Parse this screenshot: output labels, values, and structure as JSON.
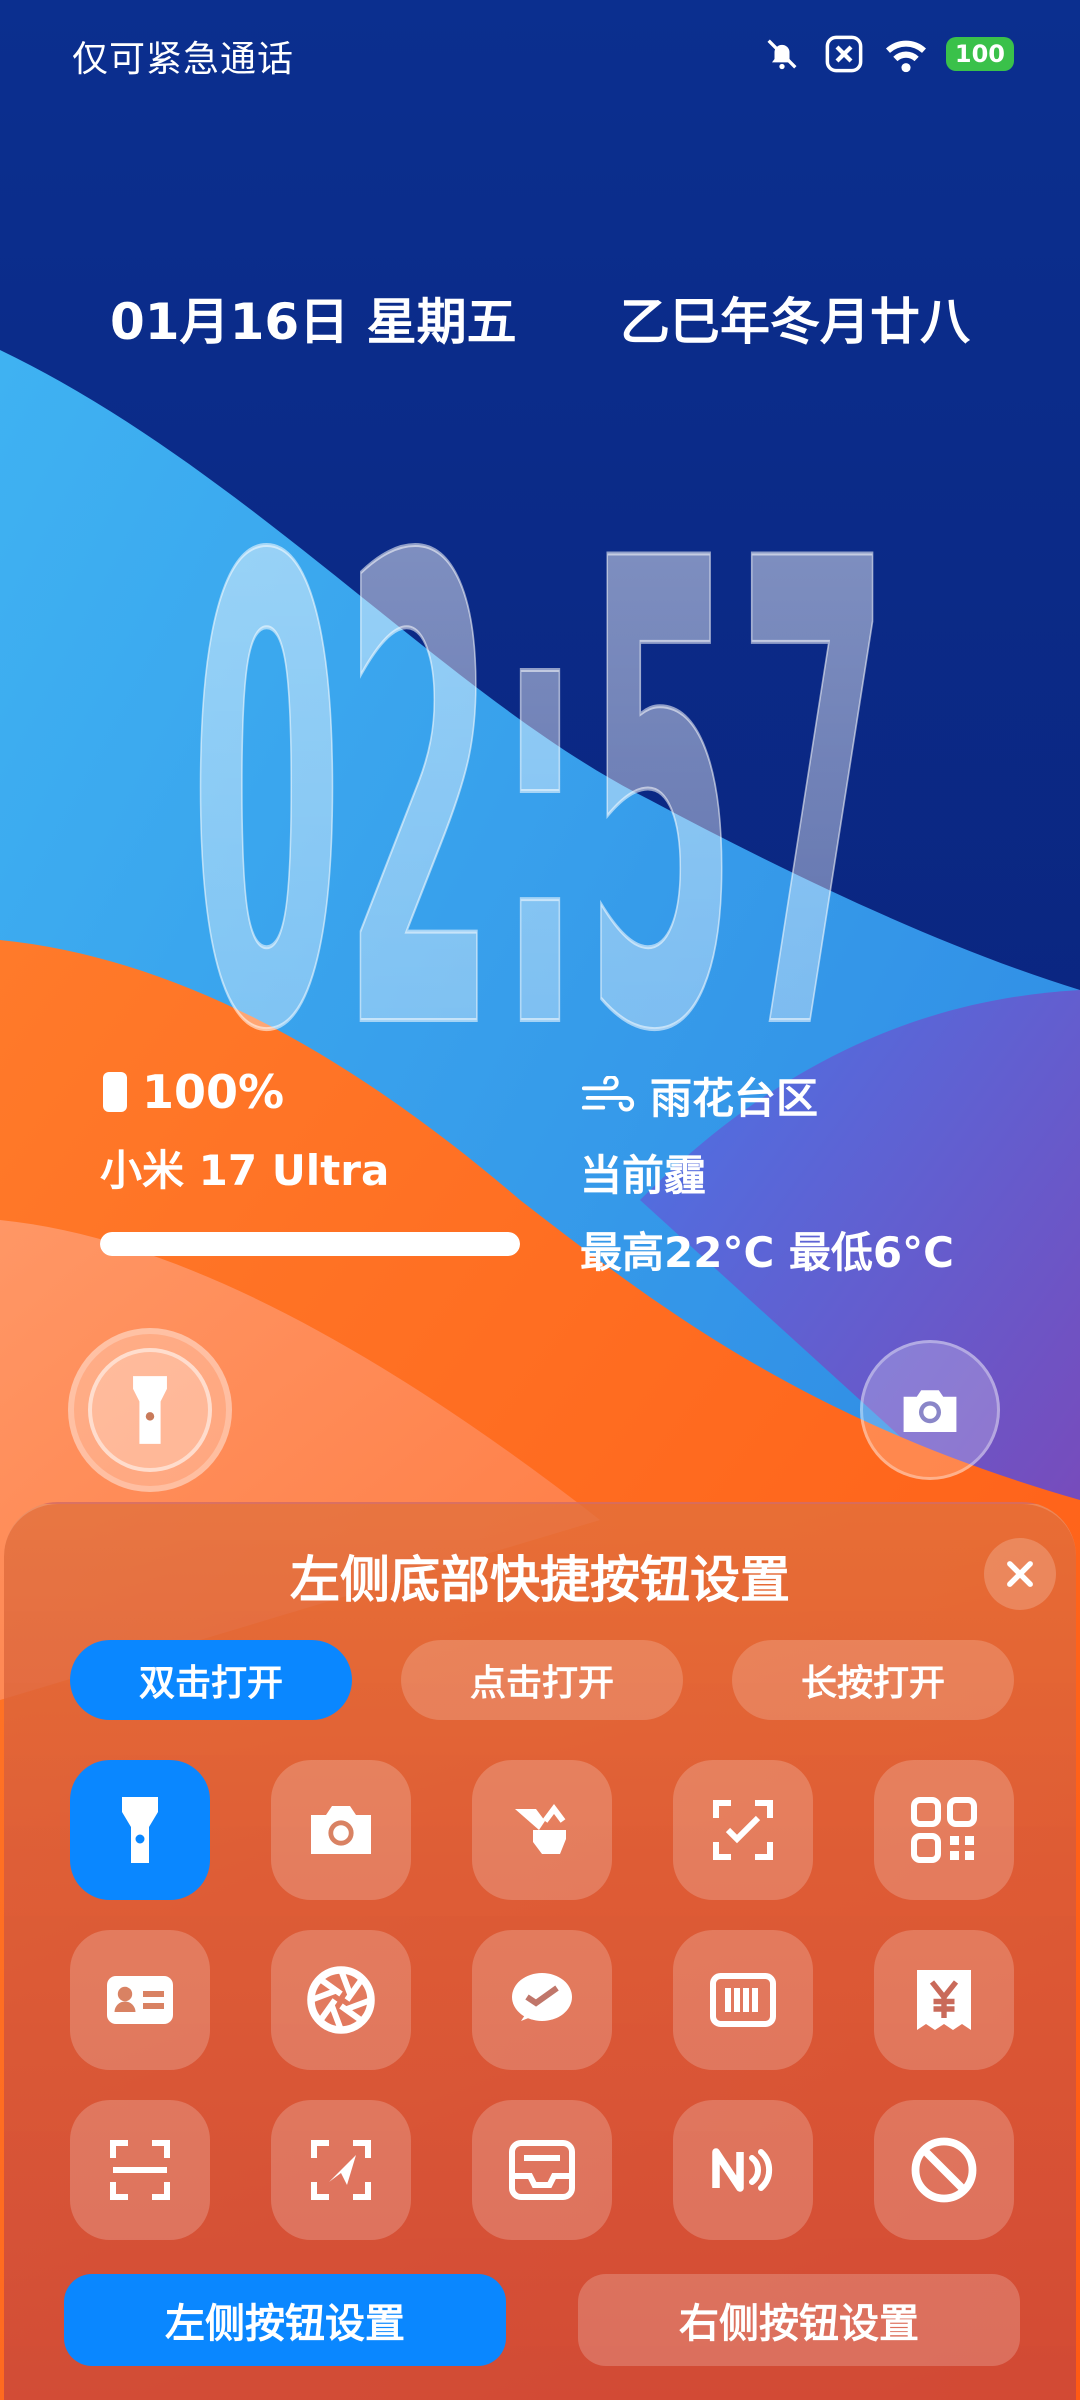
{
  "status": {
    "carrier_text": "仅可紧急通话",
    "battery_badge": "100",
    "icons": [
      "bell-off-icon",
      "close-box-icon",
      "wifi-icon",
      "battery-icon"
    ]
  },
  "date": {
    "gregorian": "01月16日 星期五",
    "lunar": "乙巳年冬月廿八"
  },
  "clock": {
    "time": "02:57"
  },
  "battery_widget": {
    "percent": "100%",
    "device": "小米 17 Ultra",
    "level": 1.0
  },
  "weather_widget": {
    "location": "雨花台区",
    "condition": "当前霾",
    "range": "最高22°C 最低6°C"
  },
  "panel": {
    "title": "左侧底部快捷按钮设置",
    "tabs": [
      {
        "label": "双击打开",
        "active": true
      },
      {
        "label": "点击打开",
        "active": false
      },
      {
        "label": "长按打开",
        "active": false
      }
    ],
    "tiles": [
      {
        "icon": "flashlight-icon",
        "active": true
      },
      {
        "icon": "camera-icon"
      },
      {
        "icon": "translate-icon"
      },
      {
        "icon": "scan-check-icon"
      },
      {
        "icon": "qr-code-icon"
      },
      {
        "icon": "id-card-icon"
      },
      {
        "icon": "aperture-icon"
      },
      {
        "icon": "wechat-pay-icon"
      },
      {
        "icon": "barcode-icon"
      },
      {
        "icon": "yuan-receipt-icon"
      },
      {
        "icon": "scan-frame-icon"
      },
      {
        "icon": "send-scan-icon"
      },
      {
        "icon": "inbox-icon"
      },
      {
        "icon": "nfc-icon"
      },
      {
        "icon": "disable-icon"
      }
    ],
    "bottom_buttons": [
      {
        "label": "左侧按钮设置",
        "active": true
      },
      {
        "label": "右侧按钮设置",
        "active": false
      }
    ]
  },
  "colors": {
    "accent_blue": "#0a87ff",
    "battery_green": "#3ac14a",
    "wallpaper_navy": "#0a1f7a",
    "wallpaper_cyan": "#2b9fe8",
    "wallpaper_orange": "#ff6a1f"
  }
}
